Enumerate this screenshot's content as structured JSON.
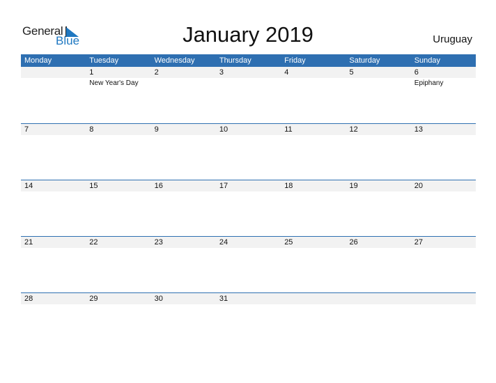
{
  "logo": {
    "general": "General",
    "blue": "Blue"
  },
  "title": "January 2019",
  "country": "Uruguay",
  "colors": {
    "accent": "#2e6fb1",
    "logo_blue": "#1f78c1",
    "date_strip": "#f2f2f2"
  },
  "days": [
    "Monday",
    "Tuesday",
    "Wednesday",
    "Thursday",
    "Friday",
    "Saturday",
    "Sunday"
  ],
  "weeks": [
    [
      {
        "d": ""
      },
      {
        "d": "1",
        "h": "New Year's Day"
      },
      {
        "d": "2"
      },
      {
        "d": "3"
      },
      {
        "d": "4"
      },
      {
        "d": "5"
      },
      {
        "d": "6",
        "h": "Epiphany"
      }
    ],
    [
      {
        "d": "7"
      },
      {
        "d": "8"
      },
      {
        "d": "9"
      },
      {
        "d": "10"
      },
      {
        "d": "11"
      },
      {
        "d": "12"
      },
      {
        "d": "13"
      }
    ],
    [
      {
        "d": "14"
      },
      {
        "d": "15"
      },
      {
        "d": "16"
      },
      {
        "d": "17"
      },
      {
        "d": "18"
      },
      {
        "d": "19"
      },
      {
        "d": "20"
      }
    ],
    [
      {
        "d": "21"
      },
      {
        "d": "22"
      },
      {
        "d": "23"
      },
      {
        "d": "24"
      },
      {
        "d": "25"
      },
      {
        "d": "26"
      },
      {
        "d": "27"
      }
    ],
    [
      {
        "d": "28"
      },
      {
        "d": "29"
      },
      {
        "d": "30"
      },
      {
        "d": "31"
      },
      {
        "d": ""
      },
      {
        "d": ""
      },
      {
        "d": ""
      }
    ]
  ]
}
